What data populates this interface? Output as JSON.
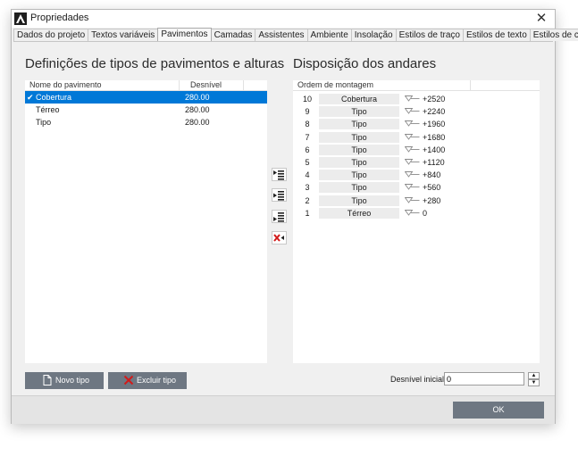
{
  "window": {
    "title": "Propriedades",
    "close_glyph": "✕",
    "app_icon": "app-logo-icon"
  },
  "tabs": [
    {
      "label": "Dados do projeto"
    },
    {
      "label": "Textos variáveis"
    },
    {
      "label": "Pavimentos"
    },
    {
      "label": "Camadas"
    },
    {
      "label": "Assistentes"
    },
    {
      "label": "Ambiente"
    },
    {
      "label": "Insolação"
    },
    {
      "label": "Estilos de traço"
    },
    {
      "label": "Estilos de texto"
    },
    {
      "label": "Estilos de cota"
    }
  ],
  "active_tab": "Pavimentos",
  "left": {
    "heading": "Definições de tipos de pavimentos e alturas",
    "columns": [
      "Nome do pavimento",
      "Desnível"
    ],
    "rows": [
      {
        "name": "Cobertura",
        "value": "280.00",
        "selected": true
      },
      {
        "name": "Térreo",
        "value": "280.00",
        "selected": false
      },
      {
        "name": "Tipo",
        "value": "280.00",
        "selected": false
      }
    ],
    "check_glyph": "✔"
  },
  "right": {
    "heading": "Disposição dos andares",
    "columns": [
      "Ordem de montagem"
    ],
    "floors": [
      {
        "num": "10",
        "name": "Cobertura",
        "level": "+2520"
      },
      {
        "num": "9",
        "name": "Tipo",
        "level": "+2240"
      },
      {
        "num": "8",
        "name": "Tipo",
        "level": "+1960"
      },
      {
        "num": "7",
        "name": "Tipo",
        "level": "+1680"
      },
      {
        "num": "6",
        "name": "Tipo",
        "level": "+1400"
      },
      {
        "num": "5",
        "name": "Tipo",
        "level": "+1120"
      },
      {
        "num": "4",
        "name": "Tipo",
        "level": "+840"
      },
      {
        "num": "3",
        "name": "Tipo",
        "level": "+560"
      },
      {
        "num": "2",
        "name": "Tipo",
        "level": "+280"
      },
      {
        "num": "1",
        "name": "Térreo",
        "level": "0"
      }
    ]
  },
  "side_buttons": [
    {
      "icon": "insert-top-icon"
    },
    {
      "icon": "insert-middle-icon"
    },
    {
      "icon": "insert-bottom-icon"
    },
    {
      "icon": "remove-floor-icon"
    }
  ],
  "buttons": {
    "new_type": "Novo tipo",
    "delete_type": "Excluir tipo",
    "ok": "OK"
  },
  "initial_level": {
    "label": "Desnível inicial:",
    "value": "0",
    "spin_up": "▲",
    "spin_down": "▼"
  },
  "colors": {
    "selection": "#0078d7",
    "button": "#6e7782",
    "delete_icon": "#d21a1a"
  }
}
